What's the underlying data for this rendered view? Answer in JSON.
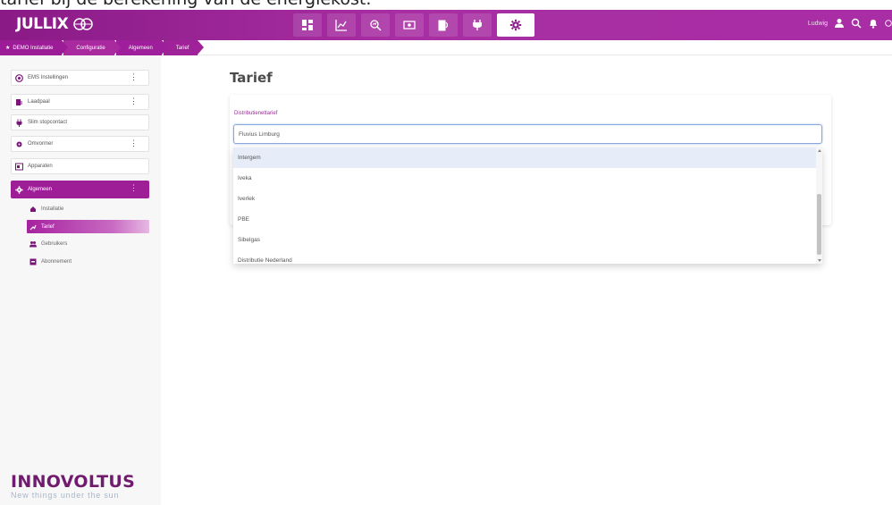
{
  "caption": "tarief bij de berekening van de energiekost.",
  "header": {
    "logo": "JULLIX",
    "user_name": "Ludwig",
    "nav_icons": [
      "dashboard-icon",
      "chart-icon",
      "analytics-icon",
      "money-icon",
      "battery-icon",
      "plug-icon",
      "gear-icon"
    ],
    "right_icons": [
      "user-icon",
      "search-icon",
      "bell-icon",
      "help-icon"
    ]
  },
  "breadcrumb": [
    "DEMO Installatie",
    "Configuratie",
    "Algemeen",
    "Tarief"
  ],
  "sidebar": {
    "items": [
      {
        "label": "EMS Instellingen",
        "icon": "ems-icon",
        "kebab": true
      },
      {
        "label": "Laadpaal",
        "icon": "charger-icon",
        "kebab": true
      },
      {
        "label": "Slim stopcontact",
        "icon": "socket-icon",
        "kebab": false
      },
      {
        "label": "Omvormer",
        "icon": "inverter-icon",
        "kebab": true
      },
      {
        "label": "Apparaten",
        "icon": "devices-icon",
        "kebab": false
      },
      {
        "label": "Algemeen",
        "icon": "gear-icon",
        "kebab": true
      }
    ],
    "sub_items": [
      {
        "label": "Installatie",
        "icon": "installation-icon"
      },
      {
        "label": "Tarief",
        "icon": "tariff-icon"
      },
      {
        "label": "Gebruikers",
        "icon": "users-icon"
      },
      {
        "label": "Abonnement",
        "icon": "subscription-icon"
      }
    ]
  },
  "brand": {
    "name": "INNOVOLTUS",
    "tagline": "New things under the sun"
  },
  "main": {
    "title": "Tarief",
    "field_label": "Distributienettarief",
    "field_value": "Fluvius Limburg",
    "options": [
      "Intergem",
      "Iveka",
      "Iverlek",
      "PBE",
      "Sibelgas",
      "Distributie Nederland"
    ],
    "highlighted_option": "Intergem"
  },
  "colors": {
    "accent": "#9e1e98",
    "brand_dark": "#701b6e",
    "input_border": "#8aa8e0"
  }
}
